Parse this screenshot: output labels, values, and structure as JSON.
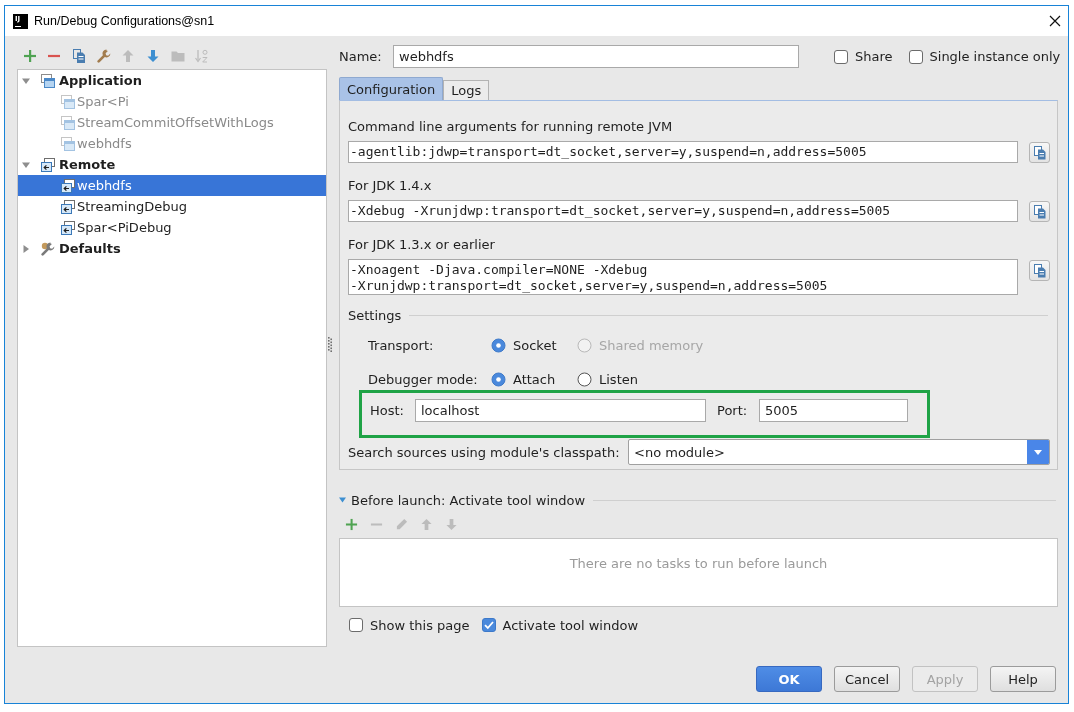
{
  "window": {
    "logo_text": "IJ",
    "title": "Run/Debug Configurations@sn1"
  },
  "toolbar": [
    {
      "kind": "add",
      "disabled": false
    },
    {
      "kind": "remove",
      "disabled": false
    },
    {
      "kind": "copy",
      "disabled": false
    },
    {
      "kind": "wrench",
      "disabled": false
    },
    {
      "kind": "up",
      "disabled": true
    },
    {
      "kind": "down",
      "disabled": false
    },
    {
      "kind": "folder",
      "disabled": true
    },
    {
      "kind": "sort",
      "disabled": true
    }
  ],
  "tree": [
    {
      "label": "Application",
      "kind": "application",
      "expanded": true,
      "selected": false,
      "children": [
        {
          "label": "Spar<Pi",
          "kind": "application",
          "temporary": true,
          "selected": false
        },
        {
          "label": "StreamCommitOffsetWithLogs",
          "kind": "application",
          "temporary": true,
          "selected": false
        },
        {
          "label": "webhdfs",
          "kind": "application",
          "temporary": true,
          "selected": false
        }
      ]
    },
    {
      "label": "Remote",
      "kind": "remote",
      "expanded": true,
      "selected": false,
      "children": [
        {
          "label": "webhdfs",
          "kind": "remote",
          "temporary": false,
          "selected": true
        },
        {
          "label": "StreamingDebug",
          "kind": "remote",
          "temporary": false,
          "selected": false
        },
        {
          "label": "Spar<PiDebug",
          "kind": "remote",
          "temporary": false,
          "selected": false
        }
      ]
    },
    {
      "label": "Defaults",
      "kind": "defaults",
      "expanded": false,
      "selected": false
    }
  ],
  "name": {
    "label": "Name:",
    "value": "webhdfs"
  },
  "options": [
    {
      "label": "Share",
      "checked": false
    },
    {
      "label": "Single instance only",
      "checked": false
    }
  ],
  "tabs": [
    {
      "label": "Configuration",
      "selected": true
    },
    {
      "label": "Logs",
      "selected": false
    }
  ],
  "arguments": [
    {
      "label": "Command line arguments for running remote JVM",
      "value": "-agentlib:jdwp=transport=dt_socket,server=y,suspend=n,address=5005"
    },
    {
      "label": "For JDK 1.4.x",
      "value": "-Xdebug -Xrunjdwp:transport=dt_socket,server=y,suspend=n,address=5005"
    },
    {
      "label": "For JDK 1.3.x or earlier",
      "value": "-Xnoagent -Djava.compiler=NONE -Xdebug\n-Xrunjdwp:transport=dt_socket,server=y,suspend=n,address=5005"
    }
  ],
  "settings": {
    "title": "Settings",
    "rows": [
      {
        "label": "Transport:",
        "options": [
          {
            "label": "Socket",
            "selected": true,
            "disabled": false
          },
          {
            "label": "Shared memory",
            "selected": false,
            "disabled": true
          }
        ]
      },
      {
        "label": "Debugger mode:",
        "options": [
          {
            "label": "Attach",
            "selected": true,
            "disabled": false
          },
          {
            "label": "Listen",
            "selected": false,
            "disabled": false
          }
        ]
      }
    ],
    "connection": {
      "highlighted": true,
      "host_label": "Host:",
      "host": "localhost",
      "port_label": "Port:",
      "port": "5005"
    },
    "module": {
      "label": "Search sources using module's classpath:",
      "value": "<no module>"
    }
  },
  "before_launch": {
    "title": "Before launch: Activate tool window",
    "expanded": true,
    "toolbar": [
      {
        "kind": "add",
        "disabled": false
      },
      {
        "kind": "remove",
        "disabled": true
      },
      {
        "kind": "edit",
        "disabled": true
      },
      {
        "kind": "up",
        "disabled": true
      },
      {
        "kind": "down",
        "disabled": true
      }
    ],
    "empty_text": "There are no tasks to run before launch"
  },
  "launch_options": [
    {
      "label": "Show this page",
      "checked": false
    },
    {
      "label": "Activate tool window",
      "checked": true
    }
  ],
  "buttons": [
    {
      "label": "OK",
      "default": true,
      "disabled": false
    },
    {
      "label": "Cancel",
      "default": false,
      "disabled": false
    },
    {
      "label": "Apply",
      "default": false,
      "disabled": true
    },
    {
      "label": "Help",
      "default": false,
      "disabled": false
    }
  ]
}
